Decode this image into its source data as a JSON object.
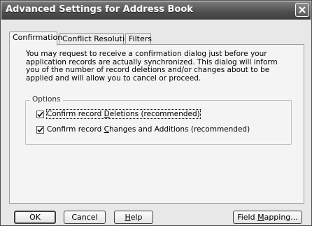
{
  "window": {
    "title": "Advanced Settings for Address Book"
  },
  "tabs": [
    {
      "label": "Confirmation",
      "active": true
    },
    {
      "label": "Conflict Resolution",
      "active": false
    },
    {
      "label": "Filters",
      "active": false
    }
  ],
  "confirmation": {
    "description": "You may request to receive a confirmation dialog just before your application records are actually synchronized.  This dialog will inform you of the number of record deletions and/or changes about to be applied and will allow you to cancel or proceed.",
    "options_legend": "Options",
    "options": [
      {
        "label_pre": "Confirm record ",
        "label_mnemonic": "D",
        "label_post": "eletions (recommended)",
        "checked": true
      },
      {
        "label_pre": "Confirm record ",
        "label_mnemonic": "C",
        "label_post": "hanges and Additions (recommended)",
        "checked": true
      }
    ]
  },
  "buttons": {
    "ok": "OK",
    "cancel": "Cancel",
    "help_mnemonic": "H",
    "help_rest": "elp",
    "field_mapping_pre": "Field ",
    "field_mapping_mnemonic": "M",
    "field_mapping_post": "apping..."
  },
  "icons": {
    "close": "close-icon",
    "checkmark": "checkmark-icon"
  }
}
